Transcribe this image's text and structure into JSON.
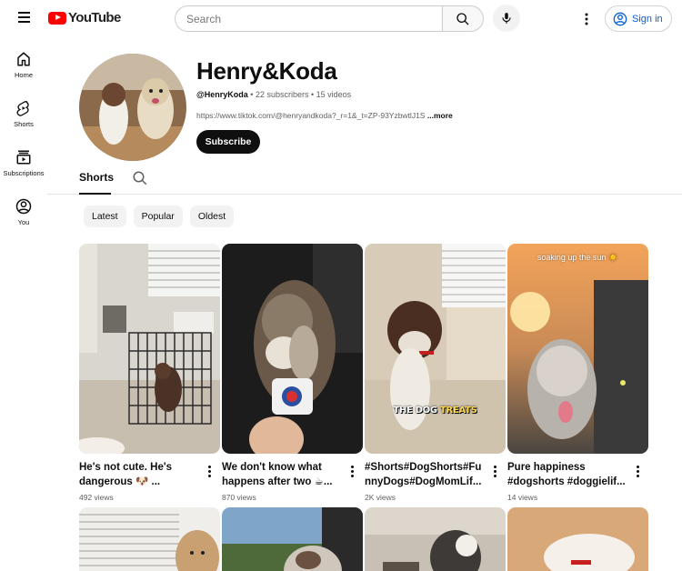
{
  "header": {
    "logo_text": "YouTube",
    "search_placeholder": "Search",
    "signin_label": "Sign in",
    "colors": {
      "brand_red": "#ff0000",
      "link_blue": "#065fd4"
    }
  },
  "sidebar": {
    "items": [
      {
        "label": "Home",
        "icon": "home-icon"
      },
      {
        "label": "Shorts",
        "icon": "shorts-icon"
      },
      {
        "label": "Subscriptions",
        "icon": "subscriptions-icon"
      },
      {
        "label": "You",
        "icon": "you-icon"
      }
    ]
  },
  "channel": {
    "name": "Henry&Koda",
    "handle": "@HenryKoda",
    "subscribers": "22 subscribers",
    "videos": "15 videos",
    "separator": " • ",
    "link": "https://www.tiktok.com/@henryandkoda?_r=1&_t=ZP-93YzbwtlJ1S",
    "more_label": "...more",
    "subscribe_label": "Subscribe"
  },
  "tabs": {
    "active": "Shorts"
  },
  "chips": [
    "Latest",
    "Popular",
    "Oldest"
  ],
  "shorts": [
    {
      "title": "He's not cute. He's dangerous 🐶 ...",
      "views": "492 views"
    },
    {
      "title": "We don't know what happens after two ☕...",
      "views": "870 views"
    },
    {
      "title": "#Shorts#DogShorts#FunnyDogs#DogMomLif...",
      "views": "2K views",
      "overlay_text_1": "THE DOG",
      "overlay_text_2": "TREATS"
    },
    {
      "title": "Pure happiness #dogshorts #doggielif...",
      "views": "14 views",
      "overlay_text": "soaking up the sun ☀️"
    }
  ]
}
